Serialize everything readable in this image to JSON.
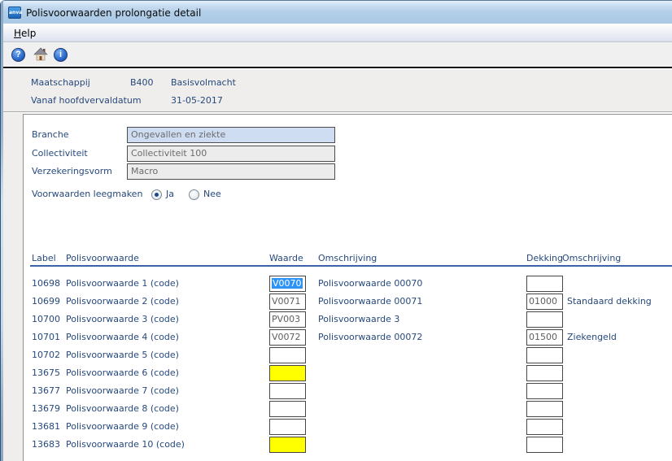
{
  "window": {
    "title": "Polisvoorwaarden prolongatie detail",
    "icon_text": "anva"
  },
  "menubar": {
    "items": [
      {
        "label": "Help"
      }
    ]
  },
  "toolbar": {
    "help_glyph": "?",
    "info_glyph": "i",
    "buttons": [
      "help",
      "home",
      "info"
    ]
  },
  "info_header": {
    "row1": {
      "label": "Maatschappij",
      "code": "B400",
      "value": "Basisvolmacht"
    },
    "row2": {
      "label": "Vanaf hoofdvervaldatum",
      "value": "31-05-2017"
    }
  },
  "form": {
    "branche": {
      "label": "Branche",
      "value": "Ongevallen en ziekte"
    },
    "collectiviteit": {
      "label": "Collectiviteit",
      "value": "Collectiviteit 100"
    },
    "verzekeringsvorm": {
      "label": "Verzekeringsvorm",
      "value": "Macro"
    },
    "leegmaken": {
      "label": "Voorwaarden leegmaken",
      "options": [
        {
          "label": "Ja",
          "selected": true
        },
        {
          "label": "Nee",
          "selected": false
        }
      ]
    }
  },
  "grid": {
    "headers": {
      "label": "Label",
      "polisvoorwaarde": "Polisvoorwaarde",
      "waarde": "Waarde",
      "omschrijving": "Omschrijving",
      "dekking": "Dekking",
      "omschrijving2": "Omschrijving"
    },
    "rows": [
      {
        "label": "10698",
        "polisvoorwaarde": "Polisvoorwaarde 1 (code)",
        "waarde": "V0070",
        "waarde_state": "selected",
        "omschrijving": "Polisvoorwaarde 00070",
        "dekking": "",
        "dekking_omschrijving": ""
      },
      {
        "label": "10699",
        "polisvoorwaarde": "Polisvoorwaarde 2 (code)",
        "waarde": "V0071",
        "waarde_state": "normal",
        "omschrijving": "Polisvoorwaarde 00071",
        "dekking": "01000",
        "dekking_omschrijving": "Standaard dekking"
      },
      {
        "label": "10700",
        "polisvoorwaarde": "Polisvoorwaarde 3 (code)",
        "waarde": "PV003",
        "waarde_state": "normal",
        "omschrijving": "Polisvoorwaarde 3",
        "dekking": "",
        "dekking_omschrijving": ""
      },
      {
        "label": "10701",
        "polisvoorwaarde": "Polisvoorwaarde 4 (code)",
        "waarde": "V0072",
        "waarde_state": "normal",
        "omschrijving": "Polisvoorwaarde 00072",
        "dekking": "01500",
        "dekking_omschrijving": "Ziekengeld"
      },
      {
        "label": "10702",
        "polisvoorwaarde": "Polisvoorwaarde 5 (code)",
        "waarde": "",
        "waarde_state": "normal",
        "omschrijving": "",
        "dekking": "",
        "dekking_omschrijving": ""
      },
      {
        "label": "13675",
        "polisvoorwaarde": "Polisvoorwaarde 6 (code)",
        "waarde": "",
        "waarde_state": "required",
        "omschrijving": "",
        "dekking": "",
        "dekking_omschrijving": ""
      },
      {
        "label": "13677",
        "polisvoorwaarde": "Polisvoorwaarde 7 (code)",
        "waarde": "",
        "waarde_state": "normal",
        "omschrijving": "",
        "dekking": "",
        "dekking_omschrijving": ""
      },
      {
        "label": "13679",
        "polisvoorwaarde": "Polisvoorwaarde 8 (code)",
        "waarde": "",
        "waarde_state": "normal",
        "omschrijving": "",
        "dekking": "",
        "dekking_omschrijving": ""
      },
      {
        "label": "13681",
        "polisvoorwaarde": "Polisvoorwaarde 9 (code)",
        "waarde": "",
        "waarde_state": "normal",
        "omschrijving": "",
        "dekking": "",
        "dekking_omschrijving": ""
      },
      {
        "label": "13683",
        "polisvoorwaarde": "Polisvoorwaarde 10 (code)",
        "waarde": "",
        "waarde_state": "required",
        "omschrijving": "",
        "dekking": "",
        "dekking_omschrijving": ""
      }
    ]
  },
  "colors": {
    "accent_navy": "#26497C",
    "selection_blue": "#2D93F5",
    "required_yellow": "#FFFF00",
    "field_blue": "#CFDDF3",
    "field_gray": "#ECECEC",
    "header_rule_blue": "#3C63A8"
  }
}
